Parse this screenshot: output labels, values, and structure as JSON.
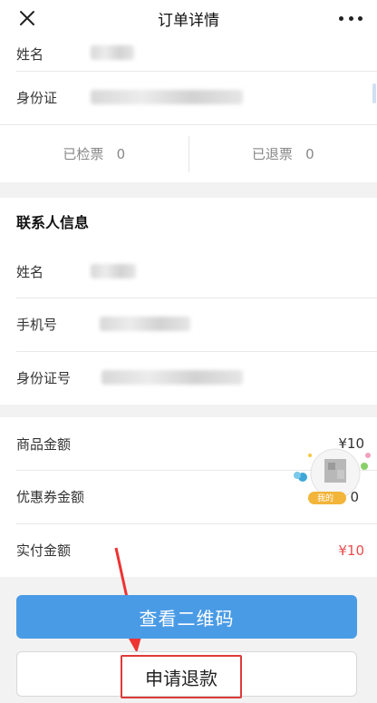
{
  "header": {
    "title": "订单详情"
  },
  "visitor": {
    "name_label": "姓名",
    "id_label": "身份证",
    "checked_label": "已检票",
    "checked_count": "0",
    "refunded_label": "已退票",
    "refunded_count": "0"
  },
  "contact": {
    "section_title": "联系人信息",
    "name_label": "姓名",
    "phone_label": "手机号",
    "id_label": "身份证号"
  },
  "pricing": {
    "goods_label": "商品金额",
    "goods_value": "¥10",
    "coupon_label": "优惠券金额",
    "coupon_value": "0",
    "paid_label": "实付金额",
    "paid_value": "¥10"
  },
  "floating_badge": {
    "text": "我的"
  },
  "buttons": {
    "qr_label": "查看二维码",
    "refund_label": "申请退款"
  },
  "colors": {
    "primary": "#4a9be6",
    "price_red": "#e94d4d",
    "highlight_red": "#e03a3a"
  }
}
